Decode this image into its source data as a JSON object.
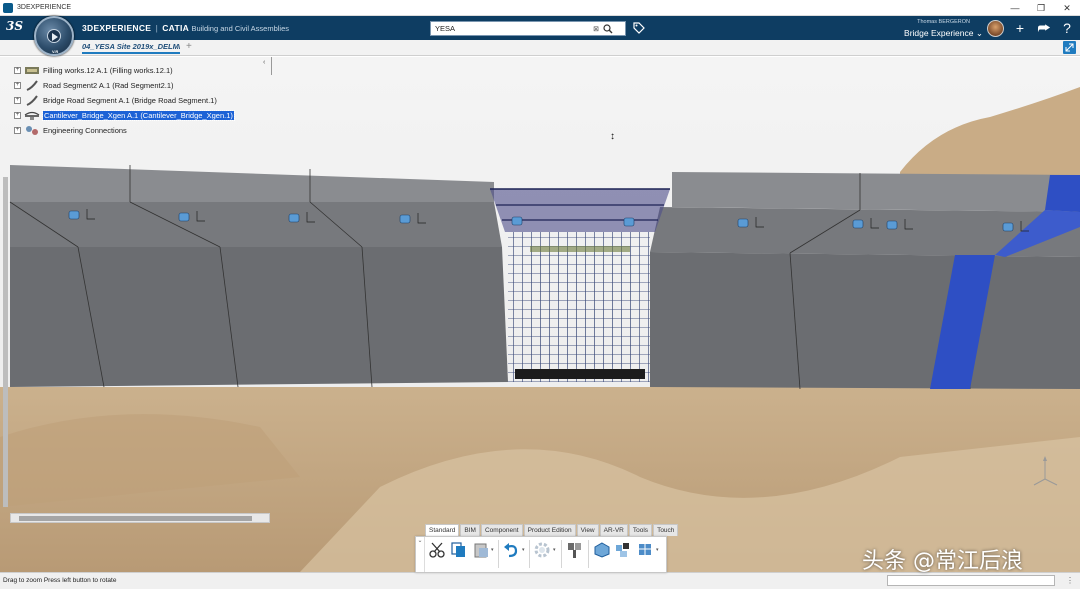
{
  "window": {
    "title": "3DEXPERIENCE",
    "minimize": "—",
    "restore": "❐",
    "close": "✕"
  },
  "header": {
    "logo": "3S",
    "compass_label": "V.R",
    "brand_bold": "3DEXPERIENCE",
    "brand_sep": "|",
    "brand_app": "CATIA",
    "brand_sub": "Building and Civil Assemblies",
    "search_value": "YESA",
    "search_clear": "⊠",
    "user_name": "Thomas BERGERON",
    "role": "Bridge Experience",
    "role_chevron": "⌄",
    "add_icon": "+",
    "share_icon": "⮫",
    "help_icon": "?"
  },
  "tabs": {
    "document": "04_YESA Site 2019x_DELMI",
    "add": "+"
  },
  "tree": {
    "collapse_arrow": "‹",
    "items": [
      {
        "expander": "+",
        "label": "Filling works.12 A.1 (Filling works.12.1)",
        "selected": false
      },
      {
        "expander": "+",
        "label": "Road Segment2 A.1 (Rad Segment2.1)",
        "selected": false
      },
      {
        "expander": "+",
        "label": "Bridge Road Segment A.1 (Bridge Road Segment.1)",
        "selected": false
      },
      {
        "expander": "+",
        "label": "Cantilever_Bridge_Xgen A.1 (Cantilever_Bridge_Xgen.1)",
        "selected": true
      },
      {
        "expander": "+",
        "label": "Engineering Connections",
        "selected": false
      }
    ]
  },
  "cursor": "↕",
  "action_bar": {
    "tabs": [
      "Standard",
      "BIM",
      "Component",
      "Product Edition",
      "View",
      "AR-VR",
      "Tools",
      "Touch"
    ],
    "active_tab": "Standard",
    "collapse": "⌄",
    "tool_icons": [
      "cut-icon",
      "copy-icon",
      "paste-icon",
      "undo-icon",
      "settings-icon",
      "engineering-icon",
      "component-icon",
      "product-icon",
      "assembly-icon"
    ]
  },
  "watermark": "头条 @常江后浪",
  "status": {
    "message": "Drag to zoom  Press left button to rotate",
    "grip": "⋮"
  },
  "colors": {
    "header_bg": "#0e3d62",
    "selection": "#1c62d6",
    "accent": "#1f7bbf",
    "highlight_blue": "#2e4fc4"
  }
}
